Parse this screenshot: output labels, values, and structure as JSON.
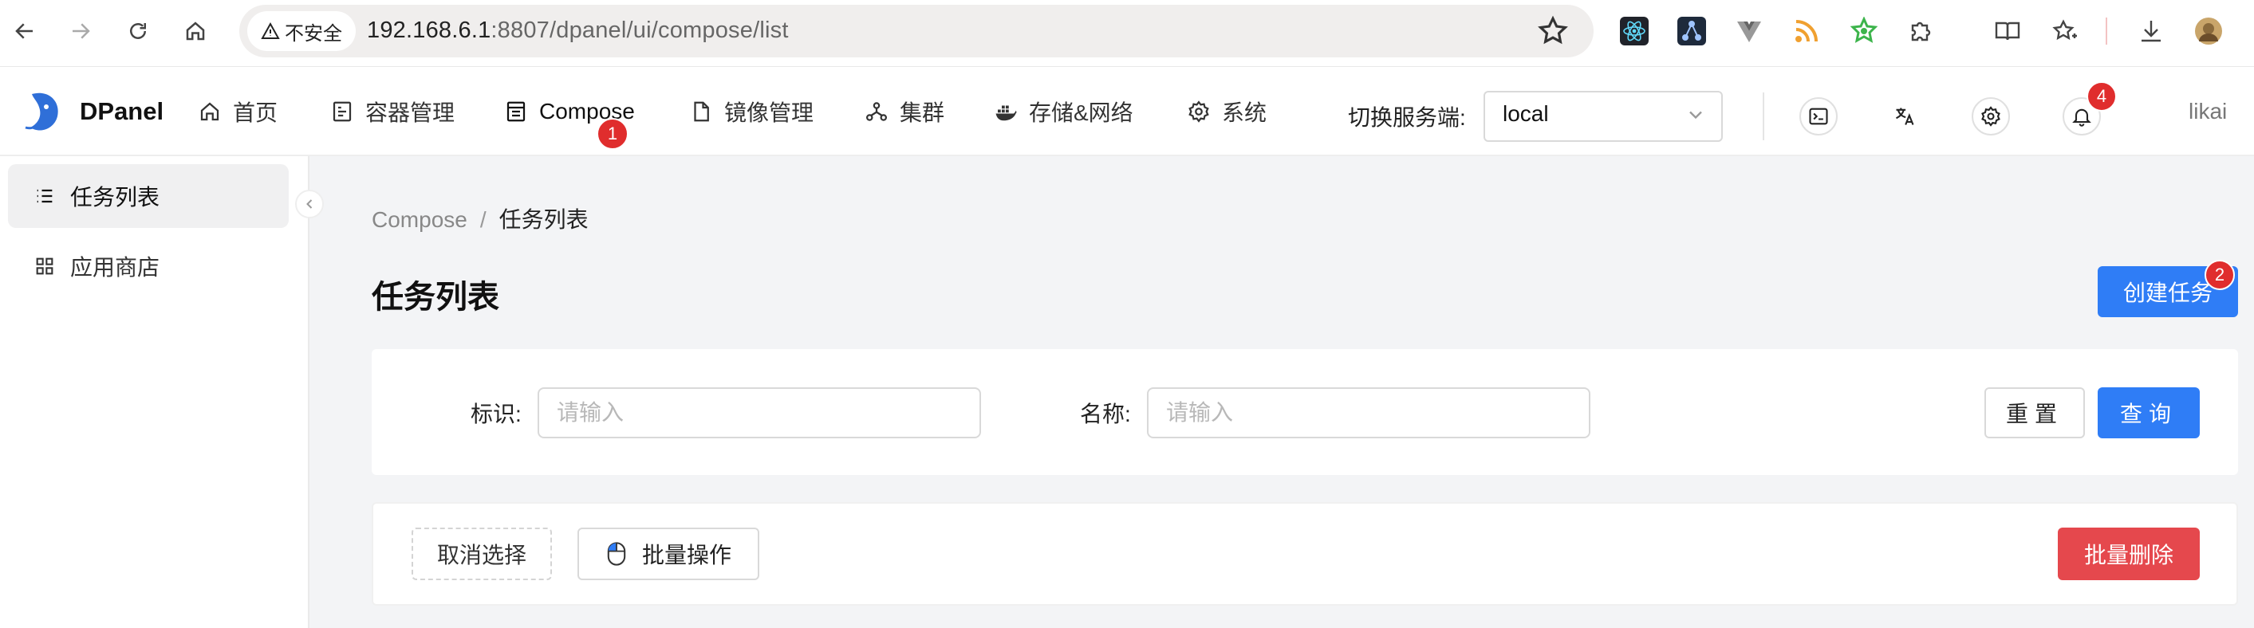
{
  "browser": {
    "security_label": "不安全",
    "url_host": "192.168.6.1",
    "url_rest": ":8807/dpanel/ui/compose/list"
  },
  "app": {
    "brand": "DPanel",
    "nav": [
      {
        "label": "首页",
        "icon": "home-icon"
      },
      {
        "label": "容器管理",
        "icon": "container-icon"
      },
      {
        "label": "Compose",
        "icon": "compose-icon",
        "badge": "1"
      },
      {
        "label": "镜像管理",
        "icon": "file-icon"
      },
      {
        "label": "集群",
        "icon": "cluster-icon"
      },
      {
        "label": "存储&网络",
        "icon": "docker-icon"
      },
      {
        "label": "系统",
        "icon": "gear-icon"
      }
    ],
    "switch_label": "切换服务端:",
    "server_value": "local",
    "notification_count": "4",
    "user": "likai"
  },
  "sidebar": {
    "items": [
      {
        "label": "任务列表",
        "icon": "list-icon",
        "active": true
      },
      {
        "label": "应用商店",
        "icon": "apps-grid-icon",
        "active": false
      }
    ]
  },
  "breadcrumb": {
    "root": "Compose",
    "separator": "/",
    "current": "任务列表"
  },
  "page": {
    "title": "任务列表",
    "create_button": "创建任务",
    "create_badge": "2"
  },
  "filters": {
    "id_label": "标识:",
    "id_placeholder": "请输入",
    "name_label": "名称:",
    "name_placeholder": "请输入",
    "reset": "重置",
    "query": "查询"
  },
  "actions": {
    "cancel_select": "取消选择",
    "batch_op": "批量操作",
    "batch_delete": "批量删除"
  },
  "colors": {
    "primary": "#2f7df6",
    "danger": "#e5484d",
    "badge": "#e02d2d"
  }
}
